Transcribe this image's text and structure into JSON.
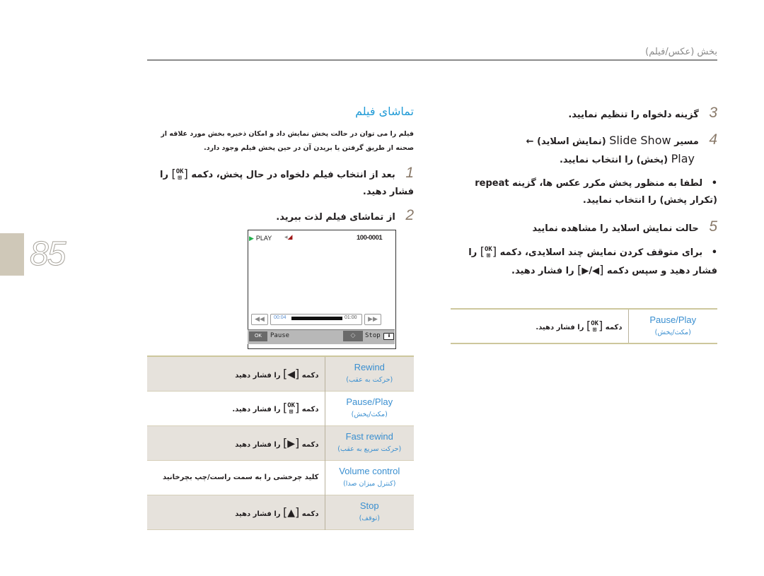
{
  "header": {
    "title": "بخش (عکس/فیلم)"
  },
  "page": {
    "number": "85"
  },
  "left": {
    "section_title": "تماشای فیلم",
    "intro": "فیلم را می توان در حالت پخش نمایش داد و امکان ذخیره بخش مورد علاقه از صحنه از طریق گرفتن یا بریدن آن در حین پخش فیلم وجود دارد.",
    "steps": [
      {
        "num": "1",
        "before": "بعد از انتخاب فیلم دلخواه در حال پخش، دکمه",
        "after": "را فشار دهید."
      },
      {
        "num": "2",
        "text": "از تماشای فیلم لذت ببرید."
      }
    ]
  },
  "screen": {
    "status": "PLAY",
    "file_number": "100-0001",
    "time_current": "00:04",
    "time_total": "01:00",
    "progress_fraction": 0.07,
    "ok_label": "OK",
    "pause_label": "Pause",
    "stop_label": "Stop",
    "battery": "III"
  },
  "icons": {
    "ok_key": "OK",
    "left": "◀",
    "right": "▶",
    "up": "▲",
    "arrow_left": "←",
    "rewind": "◀◀",
    "fastforward": "▶▶",
    "dpad": "◇",
    "play": "▶",
    "bullet": "•"
  },
  "controls_table": [
    {
      "label": "Rewind",
      "sub": "(حرکت به عقب)",
      "pre": "دکمه",
      "key": "◀",
      "post": "را فشار دهید",
      "shaded": true
    },
    {
      "label": "Pause/Play",
      "sub": "(مکث/پخش)",
      "pre": "دکمه",
      "key": "OK",
      "post": "را فشار دهید.",
      "shaded": false
    },
    {
      "label": "Fast rewind",
      "sub": "(حرکت سریع به عقب)",
      "pre": "دکمه",
      "key": "▶",
      "post": "را فشار دهید",
      "shaded": true
    },
    {
      "label": "Volume control",
      "sub": "(کنترل میزان صدا)",
      "text": "کلید چرخشی را به سمت راست/چپ بچرخانید",
      "shaded": false
    },
    {
      "label": "Stop",
      "sub": "(توقف)",
      "pre": "دکمه",
      "key": "▲",
      "post": "را فشار دهید",
      "shaded": true
    }
  ],
  "right": {
    "step3": {
      "num": "3",
      "text": "گزینه دلخواه را تنظیم نمایید."
    },
    "step4": {
      "num": "4",
      "part1": "مسیر",
      "slide_show": "Slide Show",
      "part2": "(نمایش اسلاید)",
      "play": "Play",
      "part3": "(پخش) را انتخاب نمایید."
    },
    "bullet1": {
      "part1": "لطفا به منظور پخش مکرر عکس ها، گزینه",
      "repeat": "repeat",
      "part2": "(تکرار پخش) را انتخاب نمایید."
    },
    "step5": {
      "num": "5",
      "text": "حالت نمایش اسلاید را مشاهده نمایید"
    },
    "bullet2": {
      "part1": "برای متوقف کردن نمایش چند اسلایدی، دکمه",
      "part2": "را فشار دهید و سپس دکمه",
      "key": "◀/▶",
      "part3": "را فشار دهید."
    },
    "table": [
      {
        "label": "Pause/Play",
        "sub": "(مکث/پخش)",
        "pre": "دکمه",
        "key": "OK",
        "post": "را فشار دهید."
      }
    ]
  }
}
